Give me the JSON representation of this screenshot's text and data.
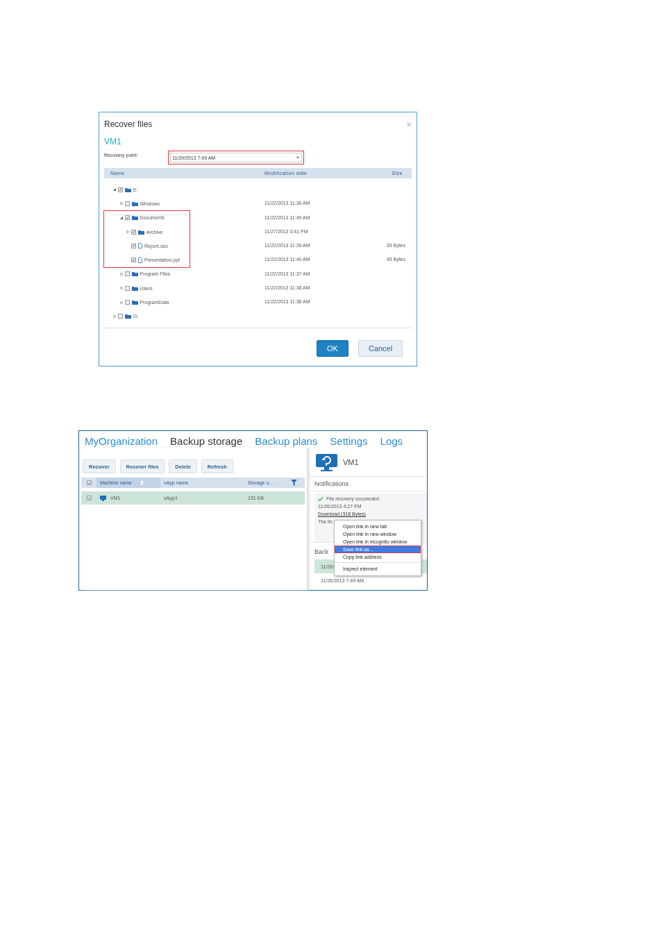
{
  "recover_dialog": {
    "title": "Recover files",
    "close": "×",
    "machine": "VM1",
    "recovery_point": {
      "label": "Recovery point:",
      "value": "11/29/2013 7:49 AM",
      "highlighted": true
    },
    "columns": [
      "Name",
      "Modification date",
      "Size"
    ],
    "tree": [
      {
        "kind": "folder",
        "name": "E:",
        "checked": true,
        "expanded": true,
        "highlighted": false,
        "children": [
          {
            "kind": "folder",
            "name": "Windows",
            "checked": false,
            "expanded": false,
            "highlighted": false,
            "date": "11/22/2013 11:36 AM"
          },
          {
            "kind": "folder",
            "name": "Documents",
            "checked": true,
            "expanded": true,
            "highlighted": true,
            "date": "11/22/2013 11:40 AM",
            "children": [
              {
                "kind": "folder",
                "name": "Archive",
                "checked": true,
                "expanded": false,
                "highlighted": false,
                "date": "11/27/2013 3:41 PM"
              },
              {
                "kind": "file",
                "name": "Report.doc",
                "checked": true,
                "highlighted": false,
                "date": "11/22/2013 11:39 AM",
                "size": "39 Bytes"
              },
              {
                "kind": "file",
                "name": "Presentation.ppt",
                "checked": true,
                "highlighted": false,
                "date": "11/22/2013 11:40 AM",
                "size": "45 Bytes"
              }
            ]
          },
          {
            "kind": "folder",
            "name": "Program Files",
            "checked": false,
            "expanded": false,
            "highlighted": false,
            "date": "11/22/2013 11:37 AM"
          },
          {
            "kind": "folder",
            "name": "Users",
            "checked": false,
            "expanded": false,
            "highlighted": false,
            "date": "11/22/2013 11:38 AM"
          },
          {
            "kind": "folder",
            "name": "ProgramData",
            "checked": false,
            "expanded": false,
            "highlighted": false,
            "date": "11/22/2013 11:38 AM"
          }
        ]
      },
      {
        "kind": "folder",
        "name": "G:",
        "checked": false,
        "expanded": false,
        "highlighted": false
      }
    ],
    "buttons": [
      {
        "label": "OK",
        "kind": "primary"
      },
      {
        "label": "Cancel",
        "kind": "secondary"
      }
    ]
  },
  "backup_portal": {
    "nav": [
      {
        "label": "MyOrganization",
        "selected": false
      },
      {
        "label": "Backup storage",
        "selected": true
      },
      {
        "label": "Backup plans",
        "selected": false
      },
      {
        "label": "Settings",
        "selected": false
      },
      {
        "label": "Logs",
        "selected": false
      }
    ],
    "toolbar": [
      "Recover",
      "Recover files",
      "Delete",
      "Refresh"
    ],
    "table": {
      "all_checked": true,
      "columns": [
        {
          "label": "Machine name",
          "sorted": true
        },
        {
          "label": "vApp name",
          "sorted": false
        },
        {
          "label": "Storage u...",
          "sorted": false
        }
      ],
      "rows": [
        {
          "checked": true,
          "selected": true,
          "cells": [
            "VM1",
            "vApp1",
            "231 KB"
          ]
        }
      ]
    },
    "details": {
      "title": "VM1",
      "notifications_heading": "Notifications",
      "notification": {
        "message": "File recovery succeeded",
        "time": "11/26/2013 4:27 PM",
        "link": "Download (318 Bytes)",
        "text": "The lin"
      },
      "backups_heading": "Back",
      "backups": [
        {
          "time": "11/26/",
          "selected": true
        },
        {
          "time": "11/26/2013 7:49 AM",
          "selected": false
        }
      ]
    },
    "context_menu": [
      {
        "label": "Open link in new tab",
        "selected": false,
        "highlighted": false
      },
      {
        "label": "Open link in new window",
        "selected": false,
        "highlighted": false
      },
      {
        "label": "Open link in incognito window",
        "selected": false,
        "highlighted": false
      },
      {
        "label": "Save link as...",
        "selected": true,
        "highlighted": true
      },
      {
        "label": "Copy link address",
        "selected": false,
        "highlighted": false
      },
      {
        "label": "Inspect element",
        "selected": false,
        "highlighted": false,
        "separated": true
      }
    ]
  }
}
